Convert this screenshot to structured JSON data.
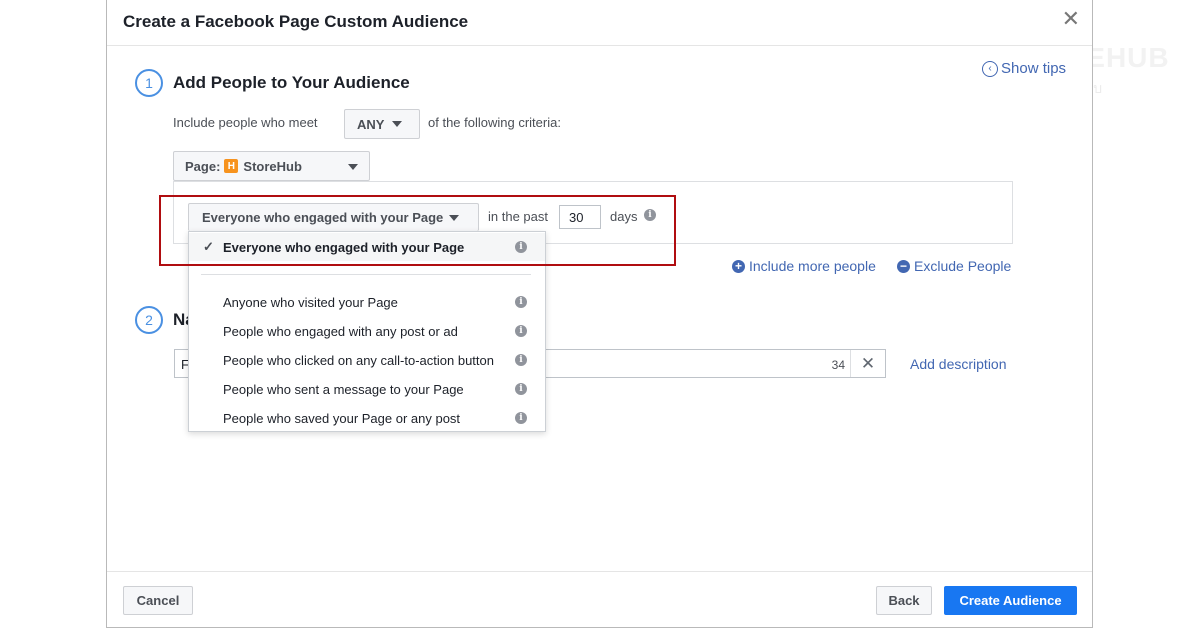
{
  "dialog": {
    "title": "Create a Facebook Page Custom Audience",
    "close": "✕"
  },
  "watermark": {
    "brand": "STOREHUB",
    "sub": "สโตร์ฮับ"
  },
  "show_tips": {
    "icon": "‹",
    "label": "Show tips"
  },
  "step1": {
    "number": "1",
    "title": "Add People to Your Audience",
    "include_prefix": "Include people who meet",
    "match_select": "ANY",
    "include_suffix": "of the following criteria:",
    "page_select": {
      "prefix": "Page:",
      "logo_glyph": "H",
      "name": "StoreHub"
    },
    "rule": {
      "engagement_select": "Everyone who engaged with your Page",
      "in_the_past": "in the past",
      "days_value": "30",
      "days_label": "days"
    },
    "include_more": "Include more people",
    "exclude": "Exclude People"
  },
  "dropdown": {
    "selected": "Everyone who engaged with your Page",
    "check": "✓",
    "items": [
      "Anyone who visited your Page",
      "People who engaged with any post or ad",
      "People who clicked on any call-to-action button",
      "People who sent a message to your Page",
      "People who saved your Page or any post"
    ]
  },
  "step2": {
    "number": "2",
    "title_visible": "Na",
    "name_value": "F",
    "char_count": "34",
    "clear": "✕",
    "add_description": "Add description"
  },
  "footer": {
    "cancel": "Cancel",
    "back": "Back",
    "create": "Create Audience"
  },
  "colors": {
    "link": "#4267b2",
    "primary_button": "#1877f2",
    "highlight_border": "#b00d10",
    "step_circle": "#4a90e2"
  }
}
